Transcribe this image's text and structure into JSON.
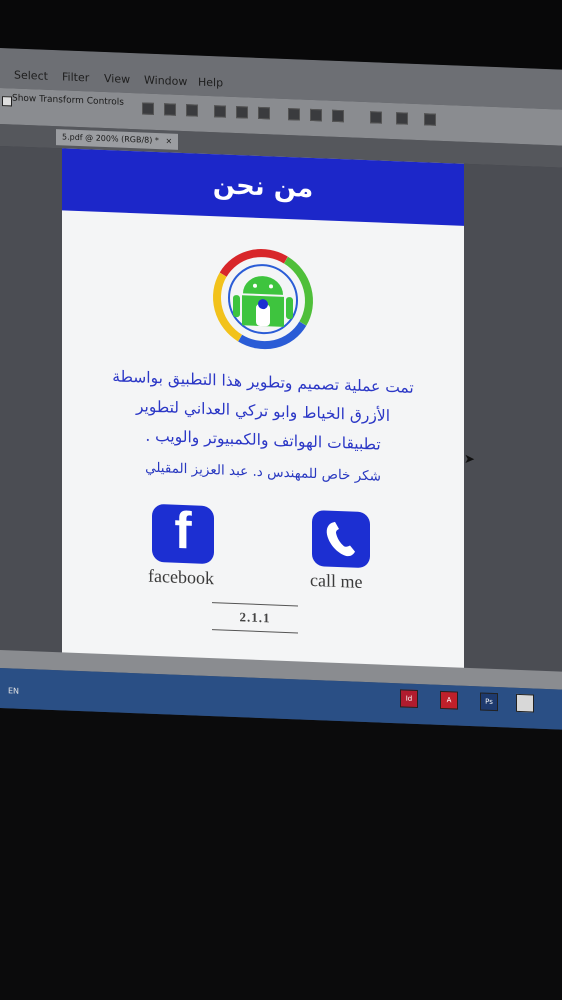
{
  "menu": {
    "items": [
      "Select",
      "Filter",
      "View",
      "Window",
      "Help"
    ]
  },
  "options_bar": {
    "show_transform_controls": "Show Transform Controls"
  },
  "document_tab": {
    "title": "5.pdf @ 200% (RGB/8) *",
    "close": "×"
  },
  "app_screen": {
    "title": "من نحن",
    "description_lines": [
      "تمت عملية تصميم وتطوير هذا التطبيق بواسطة",
      "الأزرق الخياط وابو تركي العداني لتطوير",
      "تطبيقات الهواتف والكمبيوتر والويب ."
    ],
    "thanks": "شكر خاص للمهندس د. عبد العزيز المقيلي",
    "facebook_label": "facebook",
    "call_label": "call me",
    "version": "2.1.1"
  },
  "taskbar": {
    "language": "EN"
  },
  "colors": {
    "header_blue": "#1c27c9",
    "button_blue": "#1c2fd2",
    "text_blue": "#2b37c6",
    "android_green": "#3ec43e",
    "ring_red": "#d8262a",
    "ring_green": "#4fbf3a",
    "ring_blue": "#2a5cd6",
    "ring_yellow": "#f2c21b"
  }
}
